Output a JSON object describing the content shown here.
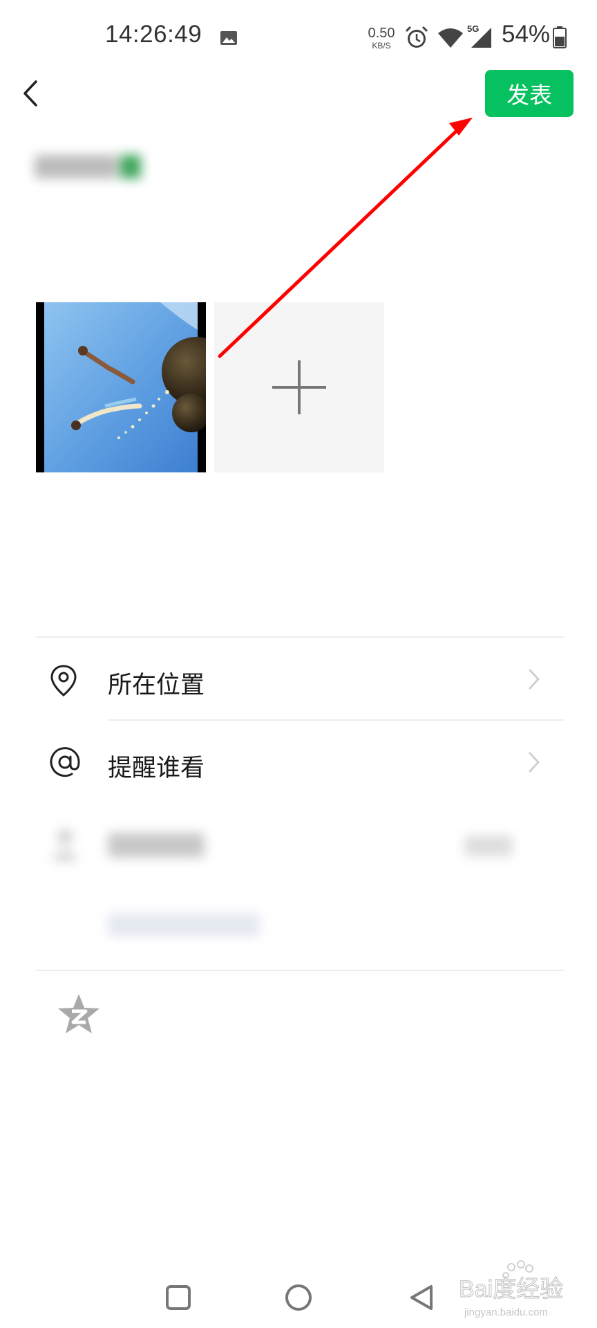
{
  "status_bar": {
    "time": "14:26:49",
    "net_speed_value": "0.50",
    "net_speed_unit": "KB/S",
    "network": "5G",
    "battery": "54%"
  },
  "header": {
    "back_icon": "chevron-left-icon",
    "publish_label": "发表"
  },
  "compose": {
    "add_icon": "plus-icon"
  },
  "options": [
    {
      "label": "所在位置",
      "icon": "location-pin-icon"
    },
    {
      "label": "提醒谁看",
      "icon": "at-sign-icon"
    }
  ],
  "colors": {
    "accent": "#07c160",
    "annotation_arrow": "#ff0000",
    "divider": "#ececec"
  },
  "watermark": {
    "brand": "Bai度经验",
    "url": "jingyan.baidu.com"
  }
}
